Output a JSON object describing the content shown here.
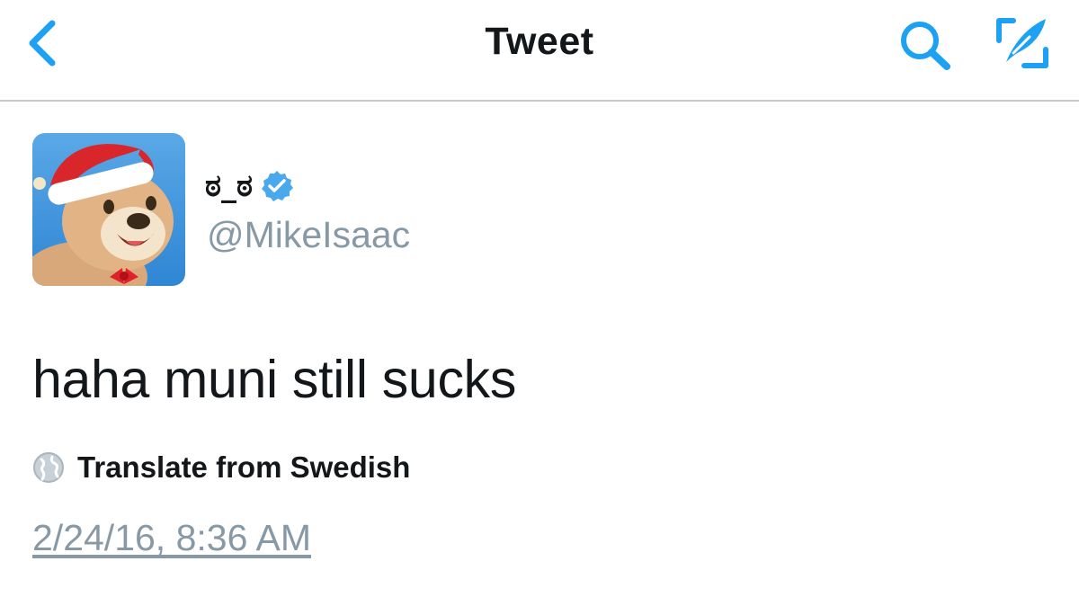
{
  "navbar": {
    "title": "Tweet",
    "back_icon": "chevron-left-icon",
    "search_icon": "search-icon",
    "compose_icon": "compose-tweet-icon",
    "accent_color": "#1da1f2"
  },
  "tweet": {
    "author": {
      "display_name": "ಠ_ಠ",
      "handle": "@MikeIsaac",
      "verified": true,
      "avatar": "cartoon-bear-santa-hat-avatar"
    },
    "text": "haha muni still sucks",
    "translate_label": "Translate from Swedish",
    "translate_icon": "globe-icon",
    "timestamp": "2/24/16, 8:36 AM"
  },
  "colors": {
    "text_primary": "#14171a",
    "text_secondary": "#8899a6",
    "verified_badge": "#4aa8ec",
    "divider": "#c8c8cc"
  }
}
